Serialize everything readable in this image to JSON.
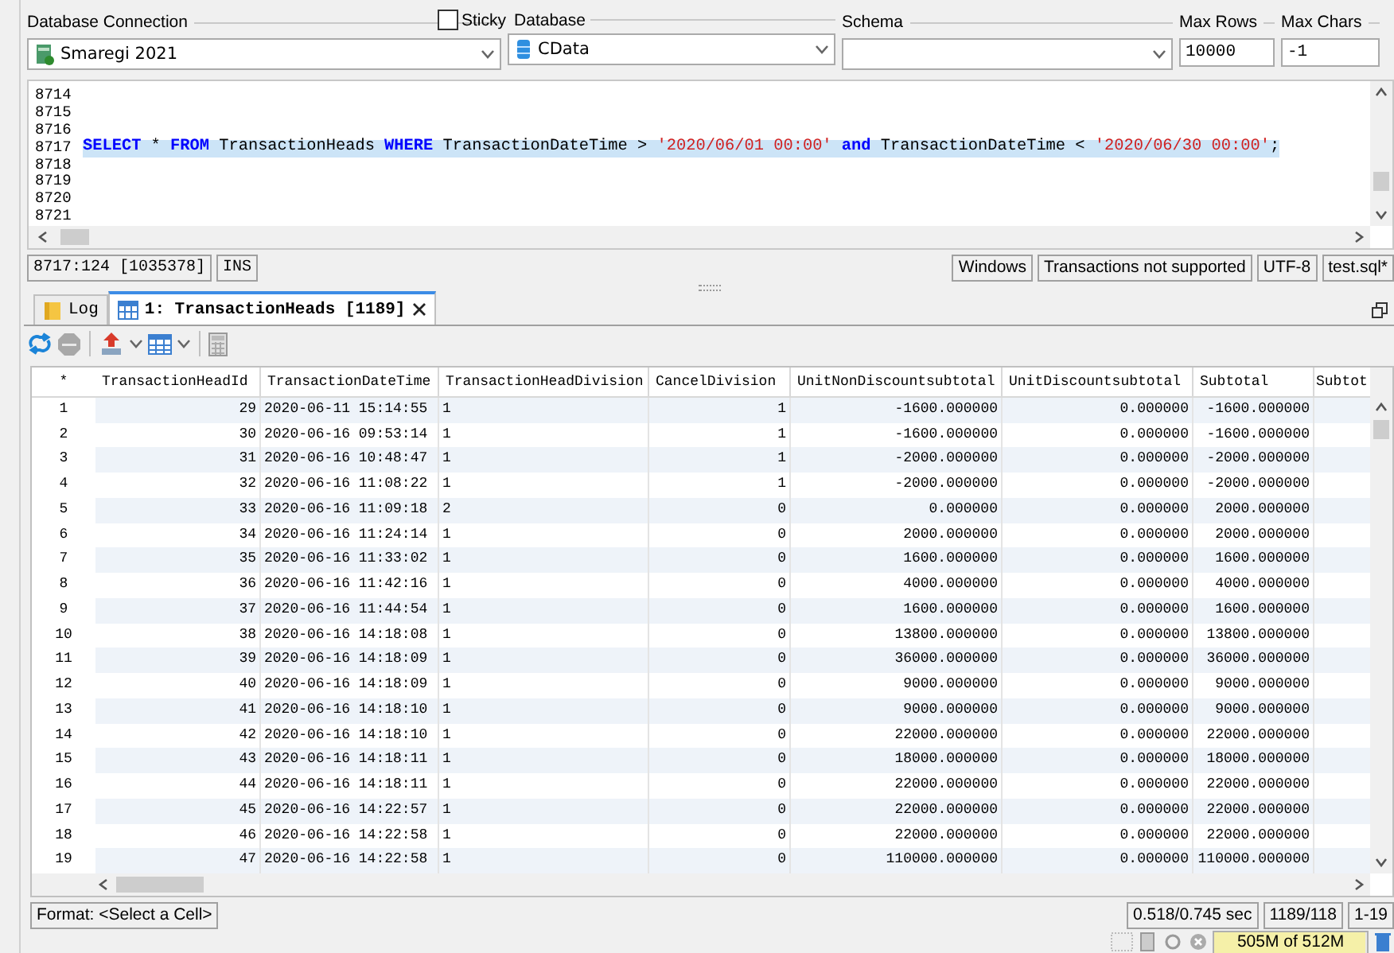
{
  "connection_bar": {
    "database_connection": {
      "label": "Database Connection",
      "value": "Smaregi 2021"
    },
    "sticky": {
      "label": "Sticky",
      "checked": false
    },
    "database": {
      "label": "Database",
      "value": "CData"
    },
    "schema": {
      "label": "Schema"
    },
    "max_rows": {
      "label": "Max Rows",
      "value": "10000"
    },
    "max_chars": {
      "label": "Max Chars",
      "value": "-1"
    }
  },
  "editor": {
    "lines": [
      {
        "number": "8714",
        "highlighted": false
      },
      {
        "number": "8715",
        "highlighted": false
      },
      {
        "number": "8716",
        "highlighted": false
      },
      {
        "number": "8717",
        "highlighted": true,
        "tokens": [
          {
            "kind": "keyword",
            "text": "SELECT"
          },
          {
            "kind": "text",
            "text": " * "
          },
          {
            "kind": "keyword",
            "text": "FROM"
          },
          {
            "kind": "text",
            "text": " TransactionHeads "
          },
          {
            "kind": "keyword",
            "text": "WHERE"
          },
          {
            "kind": "text",
            "text": " TransactionDateTime > "
          },
          {
            "kind": "string",
            "text": "'2020/06/01 00:00'"
          },
          {
            "kind": "keyword",
            "text": " and"
          },
          {
            "kind": "text",
            "text": " TransactionDateTime < "
          },
          {
            "kind": "string",
            "text": "'2020/06/30 00:00'"
          },
          {
            "kind": "text",
            "text": ";"
          }
        ]
      },
      {
        "number": "8718",
        "highlighted": false
      },
      {
        "number": "8719",
        "highlighted": false
      },
      {
        "number": "8720",
        "highlighted": false
      },
      {
        "number": "8721",
        "highlighted": false
      }
    ]
  },
  "editor_status": {
    "position": "8717:124 [1035378]",
    "mode": "INS",
    "items": [
      "Windows",
      "Transactions not supported",
      "UTF-8",
      "test.sql*"
    ]
  },
  "tabs": [
    {
      "label": "Log",
      "kind": "log",
      "selected": false,
      "closable": false
    },
    {
      "label": "1: TransactionHeads [1189]",
      "kind": "grid",
      "selected": true,
      "closable": true
    }
  ],
  "grid": {
    "corner": "*",
    "columns": [
      {
        "label": "TransactionHeadId",
        "kind": "number"
      },
      {
        "label": "TransactionDateTime",
        "kind": "text"
      },
      {
        "label": "TransactionHeadDivision",
        "kind": "text"
      },
      {
        "label": "CancelDivision",
        "kind": "number"
      },
      {
        "label": "UnitNonDiscountsubtotal",
        "kind": "number"
      },
      {
        "label": "UnitDiscountsubtotal",
        "kind": "number"
      },
      {
        "label": "Subtotal",
        "kind": "number"
      },
      {
        "label": "Subtot",
        "kind": "number"
      }
    ],
    "rows": [
      {
        "number": "1",
        "cells": [
          "29",
          "2020-06-11 15:14:55",
          "1",
          "1",
          "-1600.000000",
          "0.000000",
          "-1600.000000"
        ]
      },
      {
        "number": "2",
        "cells": [
          "30",
          "2020-06-16 09:53:14",
          "1",
          "1",
          "-1600.000000",
          "0.000000",
          "-1600.000000"
        ]
      },
      {
        "number": "3",
        "cells": [
          "31",
          "2020-06-16 10:48:47",
          "1",
          "1",
          "-2000.000000",
          "0.000000",
          "-2000.000000"
        ]
      },
      {
        "number": "4",
        "cells": [
          "32",
          "2020-06-16 11:08:22",
          "1",
          "1",
          "-2000.000000",
          "0.000000",
          "-2000.000000"
        ]
      },
      {
        "number": "5",
        "cells": [
          "33",
          "2020-06-16 11:09:18",
          "2",
          "0",
          "0.000000",
          "0.000000",
          "2000.000000"
        ]
      },
      {
        "number": "6",
        "cells": [
          "34",
          "2020-06-16 11:24:14",
          "1",
          "0",
          "2000.000000",
          "0.000000",
          "2000.000000"
        ]
      },
      {
        "number": "7",
        "cells": [
          "35",
          "2020-06-16 11:33:02",
          "1",
          "0",
          "1600.000000",
          "0.000000",
          "1600.000000"
        ]
      },
      {
        "number": "8",
        "cells": [
          "36",
          "2020-06-16 11:42:16",
          "1",
          "0",
          "4000.000000",
          "0.000000",
          "4000.000000"
        ]
      },
      {
        "number": "9",
        "cells": [
          "37",
          "2020-06-16 11:44:54",
          "1",
          "0",
          "1600.000000",
          "0.000000",
          "1600.000000"
        ]
      },
      {
        "number": "10",
        "cells": [
          "38",
          "2020-06-16 14:18:08",
          "1",
          "0",
          "13800.000000",
          "0.000000",
          "13800.000000"
        ]
      },
      {
        "number": "11",
        "cells": [
          "39",
          "2020-06-16 14:18:09",
          "1",
          "0",
          "36000.000000",
          "0.000000",
          "36000.000000"
        ]
      },
      {
        "number": "12",
        "cells": [
          "40",
          "2020-06-16 14:18:09",
          "1",
          "0",
          "9000.000000",
          "0.000000",
          "9000.000000"
        ]
      },
      {
        "number": "13",
        "cells": [
          "41",
          "2020-06-16 14:18:10",
          "1",
          "0",
          "9000.000000",
          "0.000000",
          "9000.000000"
        ]
      },
      {
        "number": "14",
        "cells": [
          "42",
          "2020-06-16 14:18:10",
          "1",
          "0",
          "22000.000000",
          "0.000000",
          "22000.000000"
        ]
      },
      {
        "number": "15",
        "cells": [
          "43",
          "2020-06-16 14:18:11",
          "1",
          "0",
          "18000.000000",
          "0.000000",
          "18000.000000"
        ]
      },
      {
        "number": "16",
        "cells": [
          "44",
          "2020-06-16 14:18:11",
          "1",
          "0",
          "22000.000000",
          "0.000000",
          "22000.000000"
        ]
      },
      {
        "number": "17",
        "cells": [
          "45",
          "2020-06-16 14:22:57",
          "1",
          "0",
          "22000.000000",
          "0.000000",
          "22000.000000"
        ]
      },
      {
        "number": "18",
        "cells": [
          "46",
          "2020-06-16 14:22:58",
          "1",
          "0",
          "22000.000000",
          "0.000000",
          "22000.000000"
        ]
      },
      {
        "number": "19",
        "cells": [
          "47",
          "2020-06-16 14:22:58",
          "1",
          "0",
          "110000.000000",
          "0.000000",
          "110000.000000"
        ]
      }
    ]
  },
  "status_bar": {
    "format": "Format: <Select a Cell>",
    "items": [
      "0.518/0.745 sec",
      "1189/118",
      "1-19"
    ]
  },
  "memory": {
    "text": "505M of 512M",
    "level": 0.986
  }
}
